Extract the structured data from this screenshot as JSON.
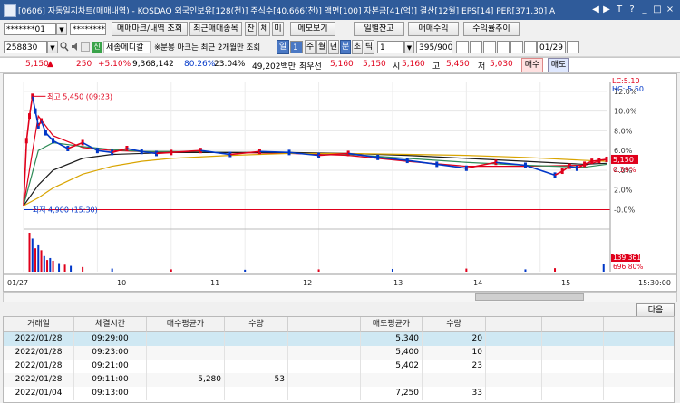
{
  "window": {
    "title": "[0606] 자동일지차트(매매내역) - KOSDAQ 외국인보유[128(천)] 주식수[40,666(천)] 액면[100] 자본금[41(억)] 결산[12월] EPS[14] PER[371.30] A",
    "controls": [
      "◀",
      "▶",
      "T",
      "?",
      "_",
      "□",
      "×"
    ]
  },
  "toolbar1": {
    "account": "*******01",
    "password": "********",
    "btn_trade_mark": "매매마크/내역 조회",
    "btn_recent_trades": "최근매매종목",
    "btn_jan": "잔",
    "btn_che": "체",
    "btn_mi": "미",
    "btn_memo": "메모보기",
    "btn_daily": "일별잔고",
    "btn_profit": "매매수익",
    "btn_profit_trend": "수익률추이"
  },
  "toolbar2": {
    "code": "258830",
    "stock_name": "세종메디칼",
    "notice": "※분봉 마크는 최근 2개월만 조회",
    "periods": [
      "일",
      "주",
      "월",
      "년",
      "분",
      "초",
      "틱"
    ],
    "period_selected": "분",
    "day_value": "1",
    "minute_value": "1",
    "count": "395/900",
    "date": "01/29"
  },
  "quote": {
    "price": "5,150",
    "change_arrow": "▲",
    "change": "250",
    "change_pct": "+5.10%",
    "volume": "9,368,142",
    "vol_ratio": "80.26%",
    "turnover": "23.04%",
    "amount": "49,202백만",
    "best_ask_label": "최우선",
    "best_ask": "5,160",
    "best_bid": "5,150",
    "open_label": "시",
    "open": "5,160",
    "high_label": "고",
    "high": "5,450",
    "low_label": "저",
    "low": "5,030",
    "buy_btn": "매수",
    "sell_btn": "매도"
  },
  "chart_data": {
    "type": "line",
    "period": "1-minute",
    "x_labels": [
      "01/27",
      "10",
      "11",
      "12",
      "13",
      "14",
      "15",
      "15:30:00"
    ],
    "y_ticks_pct": [
      "12.0%",
      "10.0%",
      "8.0%",
      "6.0%",
      "4.0%",
      "2.0%",
      "-0.0%"
    ],
    "ylim_pct": [
      -0.6,
      13.0
    ],
    "legend": [
      "LC:5.10",
      "HC:-5.50"
    ],
    "current_price_label": "5,150",
    "current_pct_label": "0.39%",
    "annotations": {
      "high": "최고 5,450 (09:23)",
      "low": "최저 4,900 (15:30)"
    },
    "volume_labels": [
      "139,361",
      "696.80%"
    ],
    "series": [
      {
        "name": "close",
        "x": [
          0,
          2,
          4,
          6,
          8,
          10,
          12,
          15,
          20,
          30,
          40,
          50,
          60,
          70,
          80,
          90,
          100,
          120,
          140,
          160,
          180,
          200,
          220,
          240,
          260,
          280,
          300,
          320,
          340,
          360,
          365,
          370,
          375,
          380,
          385,
          390,
          395
        ],
        "values": [
          0.4,
          7,
          9.5,
          11.5,
          10,
          8.5,
          9,
          7.8,
          7,
          6.2,
          6.8,
          6.0,
          5.8,
          6.2,
          5.9,
          5.7,
          5.8,
          6.0,
          5.6,
          5.9,
          5.8,
          5.5,
          5.7,
          5.3,
          5.0,
          4.6,
          4.2,
          4.8,
          4.5,
          3.5,
          3.9,
          4.4,
          4.2,
          4.6,
          4.9,
          5.0,
          5.1
        ]
      },
      {
        "name": "ma5",
        "x": [
          0,
          10,
          20,
          40,
          60,
          80,
          100,
          140,
          180,
          220,
          260,
          300,
          340,
          380,
          395
        ],
        "values": [
          0.4,
          9.5,
          7.5,
          6.3,
          6.0,
          5.9,
          5.8,
          5.8,
          5.7,
          5.5,
          4.9,
          4.4,
          4.4,
          4.5,
          5.1
        ]
      },
      {
        "name": "ma20",
        "x": [
          0,
          10,
          20,
          40,
          60,
          80,
          100,
          140,
          180,
          220,
          260,
          300,
          340,
          380,
          395
        ],
        "values": [
          0.4,
          6.0,
          6.8,
          6.4,
          6.1,
          5.9,
          5.9,
          5.8,
          5.8,
          5.6,
          5.2,
          4.8,
          4.5,
          4.3,
          4.6
        ]
      },
      {
        "name": "ma60",
        "x": [
          0,
          10,
          20,
          40,
          60,
          80,
          100,
          140,
          180,
          220,
          260,
          300,
          340,
          380,
          395
        ],
        "values": [
          0.4,
          2.5,
          4.0,
          5.2,
          5.6,
          5.7,
          5.8,
          5.8,
          5.8,
          5.7,
          5.5,
          5.2,
          4.9,
          4.6,
          4.7
        ]
      },
      {
        "name": "ma120",
        "x": [
          0,
          10,
          20,
          40,
          60,
          80,
          100,
          140,
          180,
          220,
          260,
          300,
          340,
          380,
          395
        ],
        "values": [
          0.4,
          1.2,
          2.2,
          3.6,
          4.4,
          4.9,
          5.2,
          5.5,
          5.7,
          5.7,
          5.6,
          5.5,
          5.3,
          5.0,
          4.9
        ]
      }
    ],
    "volume": [
      {
        "x": 4,
        "v": 100
      },
      {
        "x": 6,
        "v": 85
      },
      {
        "x": 8,
        "v": 60
      },
      {
        "x": 10,
        "v": 70
      },
      {
        "x": 12,
        "v": 55
      },
      {
        "x": 14,
        "v": 40
      },
      {
        "x": 16,
        "v": 30
      },
      {
        "x": 18,
        "v": 35
      },
      {
        "x": 20,
        "v": 28
      },
      {
        "x": 24,
        "v": 22
      },
      {
        "x": 28,
        "v": 18
      },
      {
        "x": 32,
        "v": 15
      },
      {
        "x": 40,
        "v": 12
      },
      {
        "x": 60,
        "v": 8
      },
      {
        "x": 100,
        "v": 6
      },
      {
        "x": 150,
        "v": 5
      },
      {
        "x": 200,
        "v": 6
      },
      {
        "x": 250,
        "v": 7
      },
      {
        "x": 300,
        "v": 8
      },
      {
        "x": 340,
        "v": 6
      },
      {
        "x": 360,
        "v": 9
      },
      {
        "x": 393,
        "v": 20
      }
    ]
  },
  "buttons": {
    "next": "다음"
  },
  "table": {
    "headers": [
      "거래일",
      "체결시간",
      "매수평균가",
      "수량",
      "",
      "매도평균가",
      "수량",
      "",
      "",
      ""
    ],
    "rows": [
      [
        "2022/01/28",
        "09:29:00",
        "",
        "",
        "",
        "5,340",
        "20",
        "",
        "",
        ""
      ],
      [
        "2022/01/28",
        "09:23:00",
        "",
        "",
        "",
        "5,400",
        "10",
        "",
        "",
        ""
      ],
      [
        "2022/01/28",
        "09:21:00",
        "",
        "",
        "",
        "5,402",
        "23",
        "",
        "",
        ""
      ],
      [
        "2022/01/28",
        "09:11:00",
        "5,280",
        "53",
        "",
        "",
        "",
        "",
        "",
        ""
      ],
      [
        "2022/01/04",
        "09:13:00",
        "",
        "",
        "",
        "7,250",
        "33",
        "",
        "",
        ""
      ]
    ]
  },
  "colors": {
    "title_bg": "#2f5b9a",
    "up": "#e0001b",
    "down": "#0037c8",
    "selected_row": "#cfe8f3"
  }
}
